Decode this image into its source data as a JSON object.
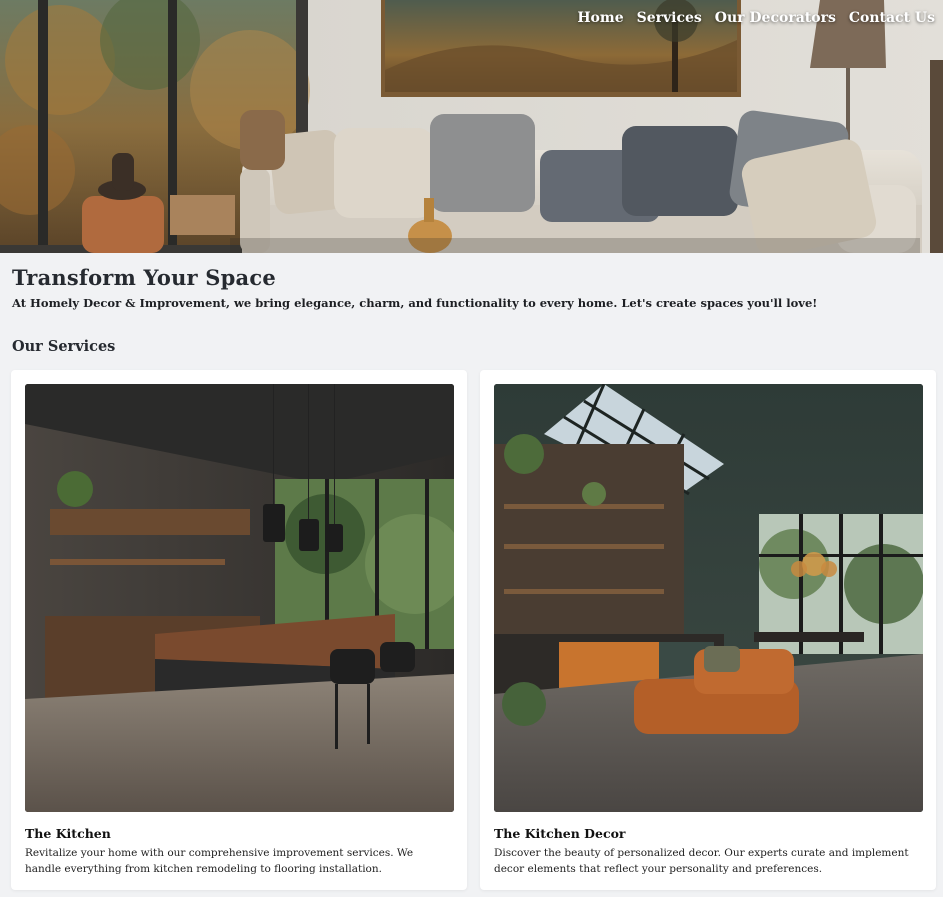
{
  "nav": {
    "items": [
      "Home",
      "Services",
      "Our Decorators",
      "Contact Us"
    ]
  },
  "intro": {
    "title": "Transform Your Space",
    "text": "At Homely Decor & Improvement, we bring elegance, charm, and functionality to every home. Let's create spaces you'll love!"
  },
  "services": {
    "heading": "Our Services",
    "cards": [
      {
        "title": "The Kitchen",
        "description": "Revitalize your home with our comprehensive improvement services. We handle everything from kitchen remodeling to flooring installation."
      },
      {
        "title": "The Kitchen Decor",
        "description": "Discover the beauty of personalized decor. Our experts curate and implement decor elements that reflect your personality and preferences."
      }
    ]
  },
  "colors": {
    "page_background": "#f1f2f4",
    "card_background": "#ffffff",
    "nav_text": "#ffffff",
    "heading_text": "#262a30"
  }
}
